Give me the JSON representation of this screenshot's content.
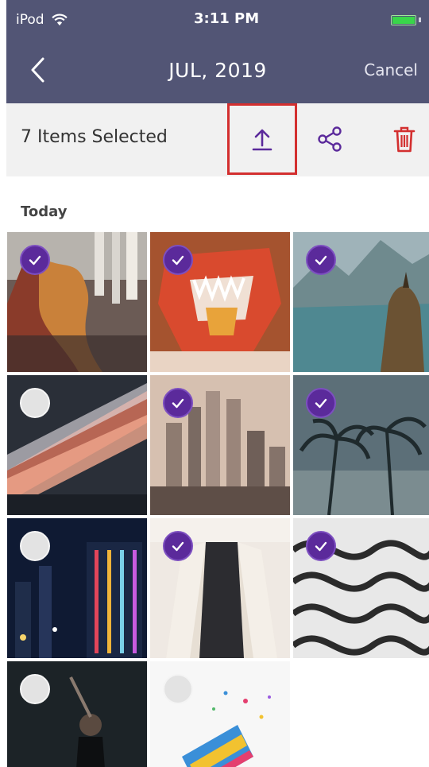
{
  "status": {
    "carrier": "iPod",
    "time": "3:11 PM"
  },
  "nav": {
    "title": "JUL, 2019",
    "cancel_label": "Cancel"
  },
  "toolbar": {
    "selected_label": "7 Items Selected",
    "icons": [
      "upload-icon",
      "share-icon",
      "trash-icon"
    ]
  },
  "section": {
    "title": "Today"
  },
  "photos": [
    {
      "subject": "dragon-dance-street",
      "selected": true
    },
    {
      "subject": "dragon-head",
      "selected": true
    },
    {
      "subject": "mountain-lake",
      "selected": true
    },
    {
      "subject": "light-trails",
      "selected": false
    },
    {
      "subject": "city-skyline",
      "selected": true
    },
    {
      "subject": "palm-trees",
      "selected": true
    },
    {
      "subject": "neon-city-night",
      "selected": false
    },
    {
      "subject": "woman-cardigan",
      "selected": true
    },
    {
      "subject": "wavy-pattern",
      "selected": true
    },
    {
      "subject": "person-dark",
      "selected": false
    },
    {
      "subject": "confetti-pinata",
      "selected": false
    }
  ],
  "colors": {
    "header": "#525575",
    "accent": "#5b2a9b",
    "highlight": "#d32f2f"
  }
}
